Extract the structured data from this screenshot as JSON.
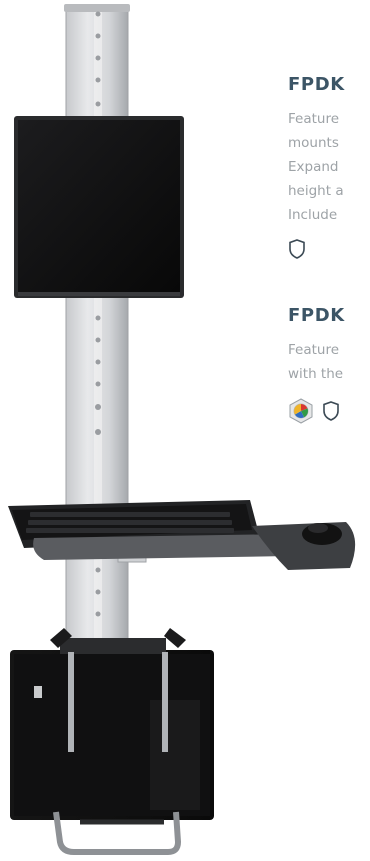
{
  "products": [
    {
      "model": "FPDK",
      "description_lines": [
        "Feature",
        "mounts",
        "Expand",
        "height a",
        "Include"
      ],
      "badges": [
        "shield-outline-icon"
      ]
    },
    {
      "model": "FPDK",
      "description_lines": [
        "Feature",
        "with the"
      ],
      "badges": [
        "hex-color-logo-icon",
        "shield-outline-icon"
      ]
    }
  ],
  "colors": {
    "model_heading": "#3c5566",
    "description_text": "#9ea3a7",
    "badge_outline": "#3c4a55"
  }
}
